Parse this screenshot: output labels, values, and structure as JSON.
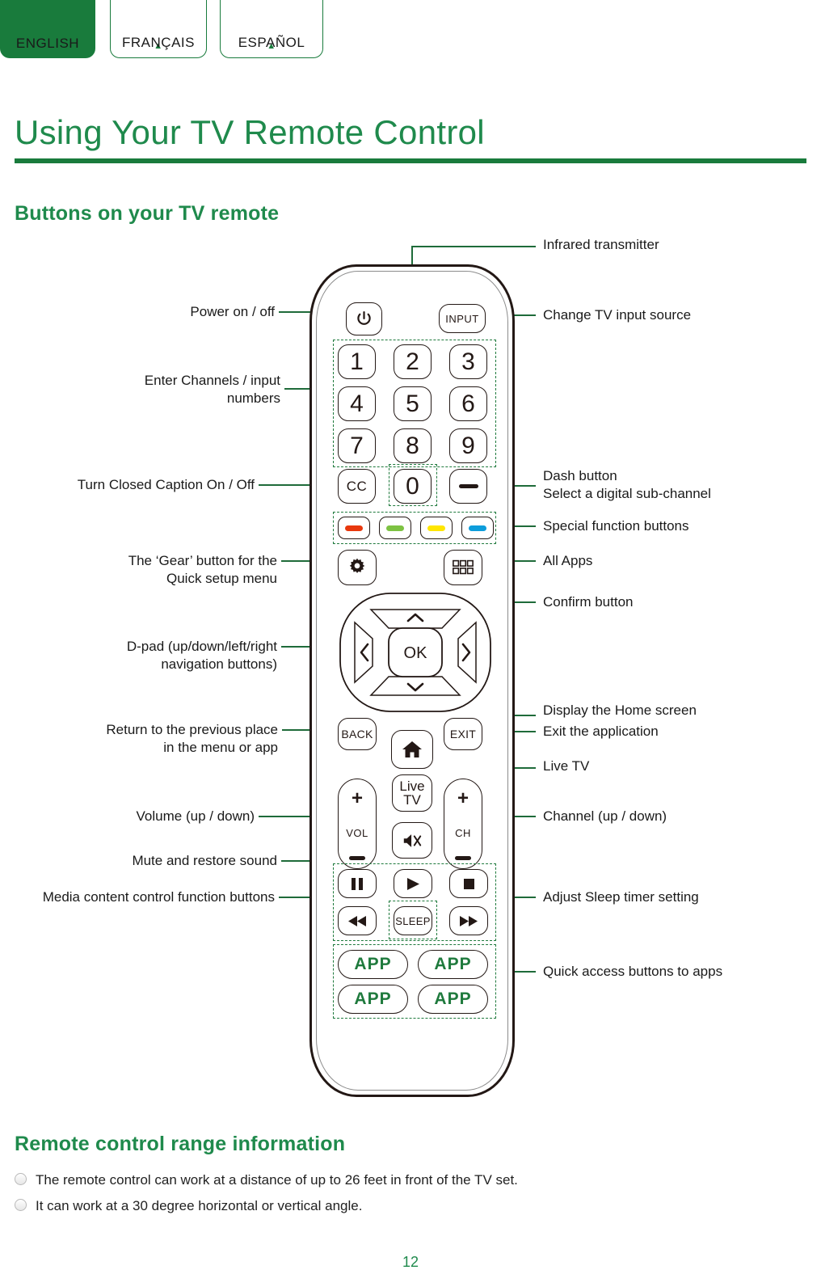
{
  "language_tabs": [
    {
      "label": "ENGLISH",
      "active": true,
      "arrow": ""
    },
    {
      "label": "FRANÇAIS",
      "active": false,
      "arrow": "▲"
    },
    {
      "label": "ESPAÑOL",
      "active": false,
      "arrow": "▲"
    }
  ],
  "page": {
    "title": "Using Your TV Remote Control",
    "number": "12"
  },
  "sections": {
    "buttons_heading": "Buttons on your TV remote",
    "range_heading": "Remote control range information"
  },
  "range_bullets": [
    "The remote control can work at a distance of up to 26 feet in front of the TV set.",
    "It can work at a 30 degree horizontal or vertical angle."
  ],
  "callouts_left": [
    {
      "id": "power",
      "text": "Power on / off"
    },
    {
      "id": "numbers",
      "text": "Enter Channels / input\nnumbers"
    },
    {
      "id": "cc",
      "text": "Turn Closed Caption On / Off"
    },
    {
      "id": "gear",
      "text": "The ‘Gear’ button for the\nQuick setup menu"
    },
    {
      "id": "dpad",
      "text": "D-pad (up/down/left/right\nnavigation buttons)"
    },
    {
      "id": "back",
      "text": "Return to the previous place\nin the menu or app"
    },
    {
      "id": "vol",
      "text": "Volume (up / down)"
    },
    {
      "id": "mute",
      "text": "Mute and restore sound"
    },
    {
      "id": "media",
      "text": "Media content control function buttons"
    }
  ],
  "callouts_right": [
    {
      "id": "ir",
      "text": "Infrared transmitter"
    },
    {
      "id": "input",
      "text": "Change TV input source"
    },
    {
      "id": "dash",
      "text": "Dash button\nSelect a digital sub-channel"
    },
    {
      "id": "special",
      "text": "Special function buttons"
    },
    {
      "id": "allapps",
      "text": "All Apps"
    },
    {
      "id": "confirm",
      "text": "Confirm button"
    },
    {
      "id": "home",
      "text": "Display the Home screen"
    },
    {
      "id": "exit",
      "text": "Exit the application"
    },
    {
      "id": "livetv",
      "text": "Live TV"
    },
    {
      "id": "ch",
      "text": "Channel (up / down)"
    },
    {
      "id": "sleep",
      "text": "Adjust Sleep timer setting"
    },
    {
      "id": "apps",
      "text": "Quick access buttons to apps"
    }
  ],
  "remote": {
    "power_icon": "power-icon",
    "input_label": "INPUT",
    "numbers": [
      "1",
      "2",
      "3",
      "4",
      "5",
      "6",
      "7",
      "8",
      "9"
    ],
    "cc_label": "CC",
    "zero_label": "0",
    "dash_label": "—",
    "color_keys": [
      {
        "name": "red-key",
        "color": "#e8380d"
      },
      {
        "name": "green-key",
        "color": "#7dc242"
      },
      {
        "name": "yellow-key",
        "color": "#ffe600"
      },
      {
        "name": "blue-key",
        "color": "#0d9ddb"
      }
    ],
    "gear_icon": "gear-icon",
    "allapps_icon": "grid-icon",
    "dpad": {
      "up": "⌃",
      "down": "⌄",
      "left": "‹",
      "right": "›",
      "ok": "OK"
    },
    "back_label": "BACK",
    "exit_label": "EXIT",
    "home_icon": "home-icon",
    "livetv_label": "Live\nTV",
    "vol": {
      "plus": "+",
      "label": "VOL",
      "minus": "—"
    },
    "ch": {
      "plus": "+",
      "label": "CH",
      "minus": "—"
    },
    "mute_icon": "mute-icon",
    "media": {
      "pause": "⏸",
      "play": "▶",
      "stop": "■",
      "rewind": "◀◀",
      "sleep": "SLEEP",
      "forward": "▶▶"
    },
    "app_buttons": [
      "APP",
      "APP",
      "APP",
      "APP"
    ]
  },
  "colors": {
    "brand_green": "#197B3C",
    "title_green": "#1f8a4c",
    "callout_line": "#1f6b3a",
    "outline": "#231815"
  }
}
